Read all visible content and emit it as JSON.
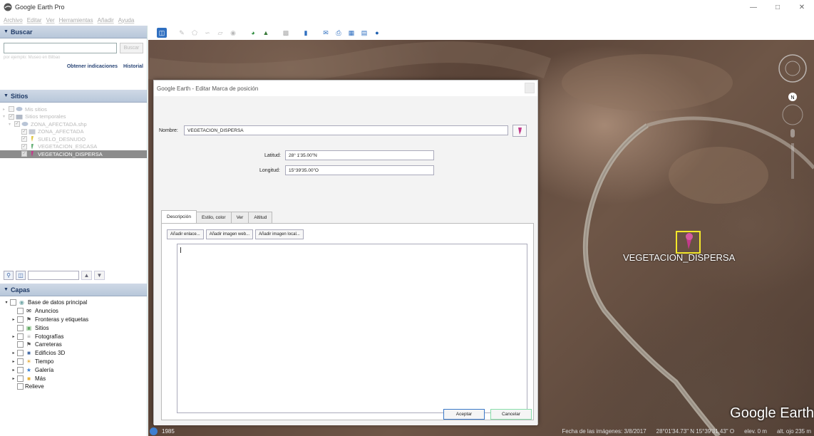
{
  "app": {
    "title": "Google Earth Pro"
  },
  "menu": [
    "Archivo",
    "Editar",
    "Ver",
    "Herramientas",
    "Añadir",
    "Ayuda"
  ],
  "search": {
    "header": "Buscar",
    "button": "Buscar",
    "hint": "por ejemplo: Museo en Bilbao",
    "link_directions": "Obtener indicaciones",
    "link_history": "Historial"
  },
  "places": {
    "header": "Sitios",
    "items": [
      {
        "label": "Mis sitios"
      },
      {
        "label": "Sitios temporales"
      },
      {
        "label": "ZONA_AFECTADA.shp"
      },
      {
        "label": "ZONA_AFECTADA"
      },
      {
        "label": "SUELO_DESNUDO"
      },
      {
        "label": "VEGETACION_ESCASA"
      },
      {
        "label": "VEGETACION_DISPERSA"
      }
    ]
  },
  "layers": {
    "header": "Capas",
    "items": [
      {
        "label": "Base de datos principal"
      },
      {
        "label": "Anuncios"
      },
      {
        "label": "Fronteras y etiquetas"
      },
      {
        "label": "Sitios"
      },
      {
        "label": "Fotografías"
      },
      {
        "label": "Carreteras"
      },
      {
        "label": "Edificios 3D"
      },
      {
        "label": "Tiempo"
      },
      {
        "label": "Galería"
      },
      {
        "label": "Más"
      },
      {
        "label": "Relieve"
      }
    ]
  },
  "dialog": {
    "title": "Google Earth - Editar Marca de posición",
    "name_label": "Nombre:",
    "name_value": "VEGETACION_DISPERSA",
    "lat_label": "Latitud:",
    "lat_value": "28° 1'35.00\"N",
    "lon_label": "Longitud:",
    "lon_value": "15°39'35.00\"O",
    "tabs": [
      "Descripción",
      "Estilo, color",
      "Ver",
      "Altitud"
    ],
    "btn_link": "Añadir enlace...",
    "btn_web_image": "Añadir imagen web...",
    "btn_local_image": "Añadir imagen local...",
    "accept": "Aceptar",
    "cancel": "Cancelar"
  },
  "map": {
    "placemark_label": "VEGETACION_DISPERSA",
    "logo": "Google Earth",
    "compass_letter": "N",
    "year": "1985",
    "imagery_date": "Fecha de las imágenes: 3/8/2017",
    "coords": "28°01'34.73\" N  15°39'31.43\" O",
    "elev": "elev.   0 m",
    "eye_alt": "alt. ojo  235 m"
  },
  "colors": {
    "accent": "#3a78c8",
    "placemark_box": "#f3e82a",
    "pin": "#c23a8a"
  }
}
